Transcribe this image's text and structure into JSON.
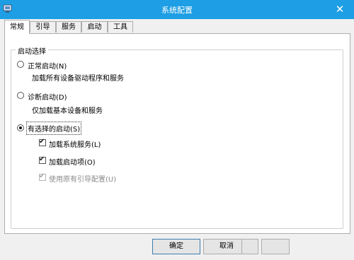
{
  "window": {
    "title": "系统配置",
    "close_glyph": "✕"
  },
  "tabs": [
    "常规",
    "引导",
    "服务",
    "启动",
    "工具"
  ],
  "group": {
    "title": "启动选择",
    "options": [
      {
        "label": "正常启动(N)",
        "desc": "加载所有设备驱动程序和服务",
        "selected": false
      },
      {
        "label": "诊断启动(D)",
        "desc": "仅加载基本设备和服务",
        "selected": false
      },
      {
        "label": "有选择的启动(S)",
        "selected": true
      }
    ],
    "checkboxes": [
      {
        "label": "加载系统服务(L)",
        "checked": true,
        "enabled": true
      },
      {
        "label": "加载启动项(O)",
        "checked": true,
        "enabled": true
      },
      {
        "label": "使用原有引导配置(U)",
        "checked": true,
        "enabled": false
      }
    ]
  },
  "buttons": {
    "ok": "确定",
    "cancel": "取消",
    "apply": "",
    "help": ""
  },
  "annotation_color": "#e8101b",
  "icons": {
    "app": "system-config-icon",
    "close": "close-icon",
    "check": "checkmark-icon"
  }
}
